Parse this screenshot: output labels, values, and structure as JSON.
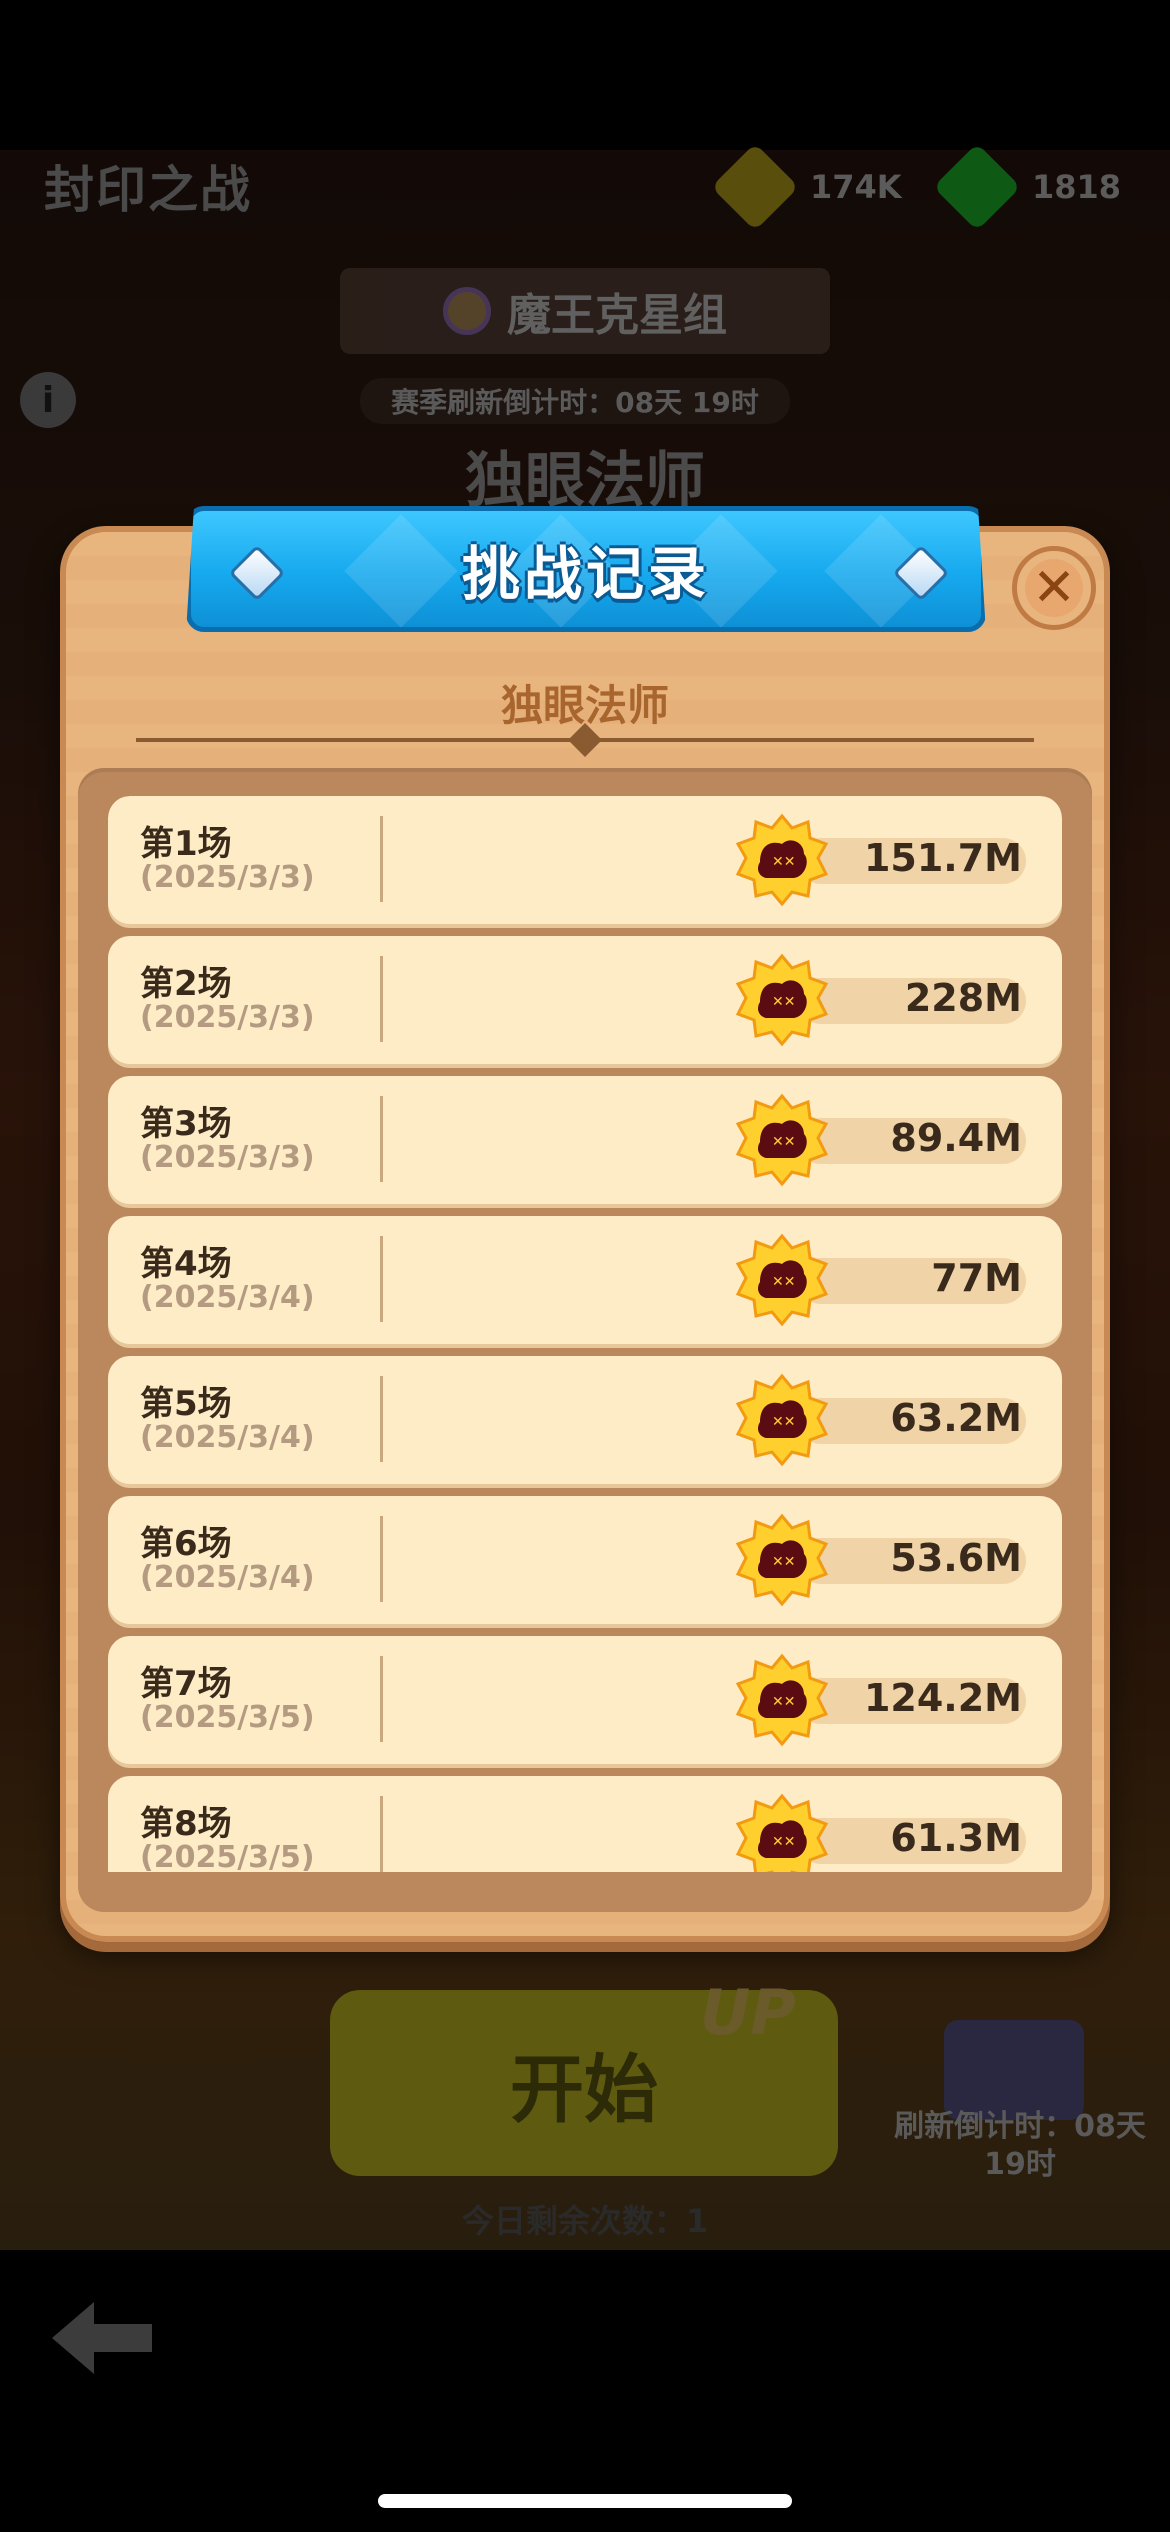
{
  "background": {
    "title": "封印之战",
    "resources": [
      {
        "icon": "gold-gem-icon",
        "value": "174K",
        "color": "#5a4e0c"
      },
      {
        "icon": "green-gem-icon",
        "value": "1818",
        "color": "#0e5a14"
      }
    ],
    "group_name": "魔王克星组",
    "season_countdown": "赛季刷新倒计时：08天 19时",
    "boss_name": "独眼法师",
    "start_label": "开始",
    "up_label": "UP",
    "refresh_countdown": "刷新倒计时：08天\n19时",
    "remaining_today": "今日剩余次数：1"
  },
  "dialog": {
    "title": "挑战记录",
    "subtitle": "独眼法师",
    "close_icon": "close-icon",
    "accent_color": "#16a9ee",
    "records": [
      {
        "label": "第1场",
        "date": "(2025/3/3)",
        "score": "151.7M"
      },
      {
        "label": "第2场",
        "date": "(2025/3/3)",
        "score": "228M"
      },
      {
        "label": "第3场",
        "date": "(2025/3/3)",
        "score": "89.4M"
      },
      {
        "label": "第4场",
        "date": "(2025/3/4)",
        "score": "77M"
      },
      {
        "label": "第5场",
        "date": "(2025/3/4)",
        "score": "63.2M"
      },
      {
        "label": "第6场",
        "date": "(2025/3/4)",
        "score": "53.6M"
      },
      {
        "label": "第7场",
        "date": "(2025/3/5)",
        "score": "124.2M"
      },
      {
        "label": "第8场",
        "date": "(2025/3/5)",
        "score": "61.3M"
      }
    ]
  }
}
